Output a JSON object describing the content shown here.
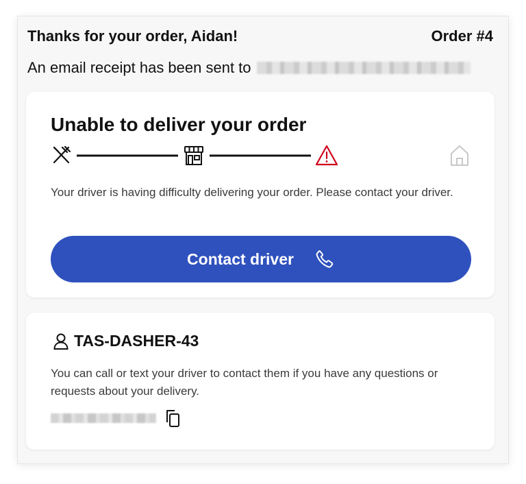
{
  "header": {
    "thanks": "Thanks for your order, Aidan!",
    "order_number": "Order #4"
  },
  "receipt": {
    "text": "An email receipt has been sent to"
  },
  "status_card": {
    "title": "Unable to deliver your order",
    "steps": [
      {
        "icon": "utensils-icon",
        "state": "done"
      },
      {
        "icon": "store-icon",
        "state": "done"
      },
      {
        "icon": "warning-icon",
        "state": "alert"
      },
      {
        "icon": "home-icon",
        "state": "pending"
      }
    ],
    "message": "Your driver is having difficulty delivering your order. Please contact your driver.",
    "contact_button": "Contact driver",
    "colors": {
      "button": "#2f51bd",
      "alert": "#d0021b",
      "pending": "#c8c8c8"
    }
  },
  "driver_card": {
    "name": "TAS-DASHER-43",
    "message": "You can call or text your driver to contact them if you have any questions or requests about your delivery."
  }
}
